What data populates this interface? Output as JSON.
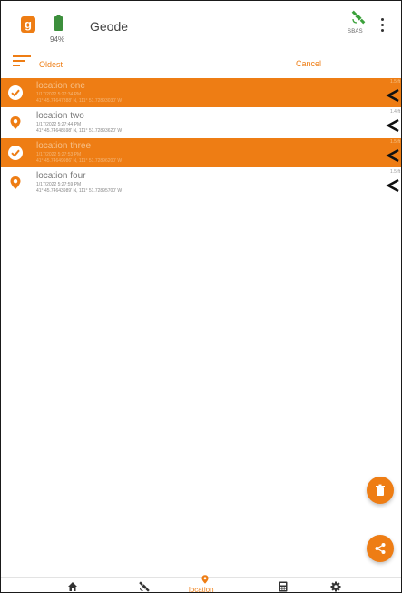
{
  "header": {
    "app_icon_letter": "g",
    "battery_percent": "94%",
    "title": "Geode",
    "satellite_status": "SBAS",
    "brand_color": "#ee7d14"
  },
  "sortbar": {
    "sort_label": "Oldest",
    "cancel_label": "Cancel"
  },
  "locations": [
    {
      "name": "location one",
      "time": "1/17/2022 5:27:34 PM",
      "coords": "41° 45.74647388' N, 111° 51.72893030' W",
      "accuracy": "1.5 ft",
      "selected": true
    },
    {
      "name": "location two",
      "time": "1/17/2022 5:27:44 PM",
      "coords": "41° 45.74648598' N, 111° 51.72893620' W",
      "accuracy": "1.4 ft",
      "selected": false
    },
    {
      "name": "location three",
      "time": "1/17/2022 5:27:53 PM",
      "coords": "41° 45.74649986' N, 111° 51.72896200' W",
      "accuracy": "1.5 ft",
      "selected": true
    },
    {
      "name": "location four",
      "time": "1/17/2022 5:27:59 PM",
      "coords": "41° 45.74643989' N, 111° 51.72895700' W",
      "accuracy": "1.5 ft",
      "selected": false
    }
  ],
  "fabs": {
    "delete_icon": "trash-icon",
    "share_icon": "share-icon"
  },
  "bottom_nav": {
    "items": [
      {
        "icon": "home-icon",
        "label": ""
      },
      {
        "icon": "satellite-icon",
        "label": ""
      },
      {
        "icon": "location-pin-icon",
        "label": "location",
        "active": true
      },
      {
        "icon": "calculator-icon",
        "label": ""
      },
      {
        "icon": "gear-icon",
        "label": ""
      }
    ]
  }
}
